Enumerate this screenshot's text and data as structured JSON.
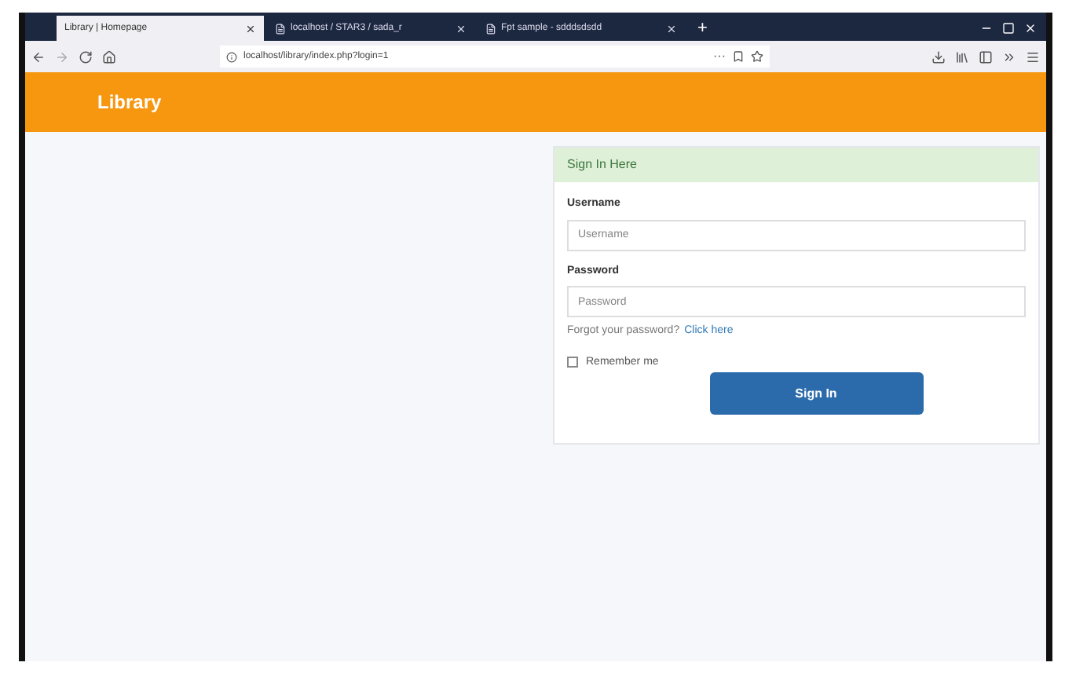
{
  "browser": {
    "tabs": [
      {
        "title": "Library | Homepage",
        "selected": true
      },
      {
        "title": "localhost / STAR3 / sada_r",
        "selected": false
      },
      {
        "title": "Fpt sample - sdddsdsdd",
        "selected": false
      }
    ],
    "new_tab": "+",
    "url": "localhost/library/index.php?login=1",
    "page_actions": "···"
  },
  "navbar": {
    "brand": "Library"
  },
  "signin": {
    "heading": "Sign In Here",
    "username_label": "Username",
    "username_placeholder": "Username",
    "password_label": "Password",
    "password_placeholder": "Password",
    "forgot_text": "Forgot your password?",
    "forgot_link": "Click here",
    "remember": {
      "label": "Remember me",
      "checked": false
    },
    "submit": "Sign In"
  }
}
